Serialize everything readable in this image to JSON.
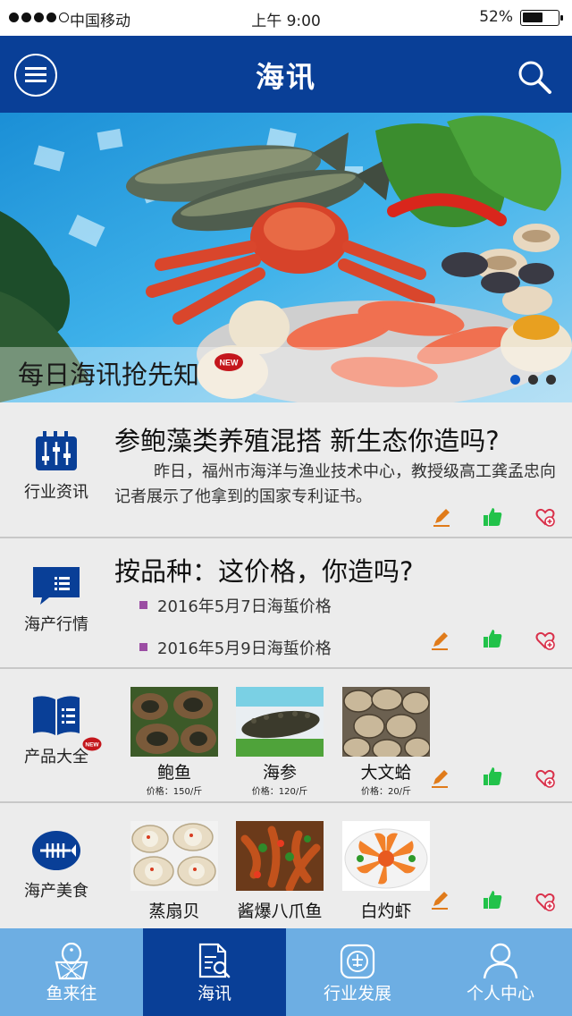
{
  "status_bar": {
    "carrier": "中国移动",
    "time": "上午 9:00",
    "battery": "52%",
    "battery_level": 0.52
  },
  "nav": {
    "title": "海讯",
    "menu_icon": "menu-icon",
    "search_icon": "search-icon"
  },
  "banner": {
    "caption": "每日海讯抢先知",
    "badge": "NEW",
    "pages": 3,
    "active_page": 1
  },
  "news": {
    "category": "行业资讯",
    "headline": "参鲍藻类养殖混搭 新生态你造吗?",
    "summary": "昨日，福州市海洋与渔业技术中心，教授级高工龚孟忠向记者展示了他拿到的国家专利证书。"
  },
  "market": {
    "category": "海产行情",
    "headline": "按品种：这价格，你造吗?",
    "items": [
      "2016年5月7日海蜇价格",
      "2016年5月9日海蜇价格"
    ]
  },
  "products": {
    "category": "产品大全",
    "badge": "NEW",
    "items": [
      {
        "name": "鲍鱼",
        "price": "价格：150/斤"
      },
      {
        "name": "海参",
        "price": "价格：120/斤"
      },
      {
        "name": "大文蛤",
        "price": "价格：20/斤"
      }
    ]
  },
  "food": {
    "category": "海产美食",
    "items": [
      {
        "name": "蒸扇贝"
      },
      {
        "name": "酱爆八爪鱼"
      },
      {
        "name": "白灼虾"
      }
    ]
  },
  "tabbar": {
    "tabs": [
      {
        "label": "鱼来往",
        "icon": "fish-basket-icon"
      },
      {
        "label": "海讯",
        "icon": "news-search-icon"
      },
      {
        "label": "行业发展",
        "icon": "industry-icon"
      },
      {
        "label": "个人中心",
        "icon": "user-icon"
      }
    ],
    "active": "海讯"
  },
  "colors": {
    "primary": "#093f97",
    "tab_inactive": "#6daee3",
    "edit": "#e07b1a",
    "like": "#22c24a",
    "favorite": "#d9304a",
    "bullet": "#9b4da3"
  }
}
